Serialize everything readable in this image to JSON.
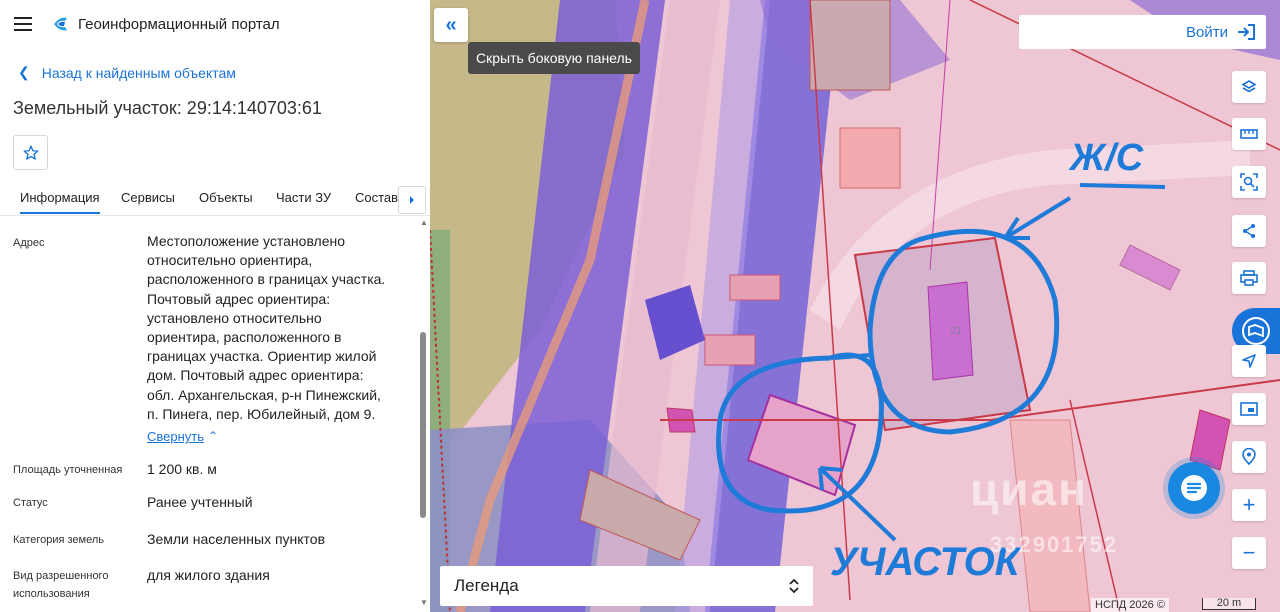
{
  "app": {
    "title": "Геоинформационный портал"
  },
  "nav": {
    "back_label": "Назад к найденным объектам"
  },
  "object": {
    "title": "Земельный участок: 29:14:140703:61"
  },
  "tabs": [
    {
      "label": "Информация"
    },
    {
      "label": "Сервисы"
    },
    {
      "label": "Объекты"
    },
    {
      "label": "Части ЗУ"
    },
    {
      "label": "Состав"
    }
  ],
  "properties": {
    "address": {
      "label": "Адрес",
      "lines": [
        "Местоположение установлено",
        "относительно ориентира,",
        "расположенного в границах участка.",
        "Почтовый адрес ориентира:",
        "установлено относительно",
        "ориентира, расположенного в",
        "границах участка. Ориентир жилой",
        "дом. Почтовый адрес ориентира:",
        "обл. Архангельская, р-н Пинежский,",
        "п. Пинега, пер. Юбилейный, дом 9."
      ],
      "collapse_label": "Свернуть"
    },
    "area": {
      "label": "Площадь уточненная",
      "value": "1 200 кв. м"
    },
    "status": {
      "label": "Статус",
      "value": "Ранее учтенный"
    },
    "category": {
      "label": "Категория земель",
      "value": "Земли населенных пунктов"
    },
    "usage": {
      "label_line1": "Вид разрешенного",
      "label_line2": "использования",
      "value": "для жилого здания"
    }
  },
  "map": {
    "hide_panel_tooltip": "Скрыть боковую панель",
    "login_label": "Войти",
    "legend_label": "Легенда",
    "attribution": "НСПД 2026 ©",
    "scale_label": "20 m",
    "house_number": "21",
    "annotation_top": "Ж/С",
    "annotation_bottom": "УЧАСТОК",
    "watermark": "циан",
    "watermark_number": "332901752"
  },
  "tools": [
    {
      "icon": "layers-icon"
    },
    {
      "icon": "ruler-icon"
    },
    {
      "icon": "area-select-icon"
    },
    {
      "icon": "share-icon"
    },
    {
      "icon": "print-icon"
    },
    {
      "icon": "navigate-icon"
    },
    {
      "icon": "minimap-icon"
    },
    {
      "icon": "location-pin-icon"
    },
    {
      "icon": "zoom-in-icon"
    },
    {
      "icon": "zoom-out-icon"
    }
  ],
  "colors": {
    "accent": "#1a73d9",
    "map_pink": "#efc6d3",
    "map_purple": "#7b5fd6",
    "sketch_blue": "#1f7bd8"
  }
}
